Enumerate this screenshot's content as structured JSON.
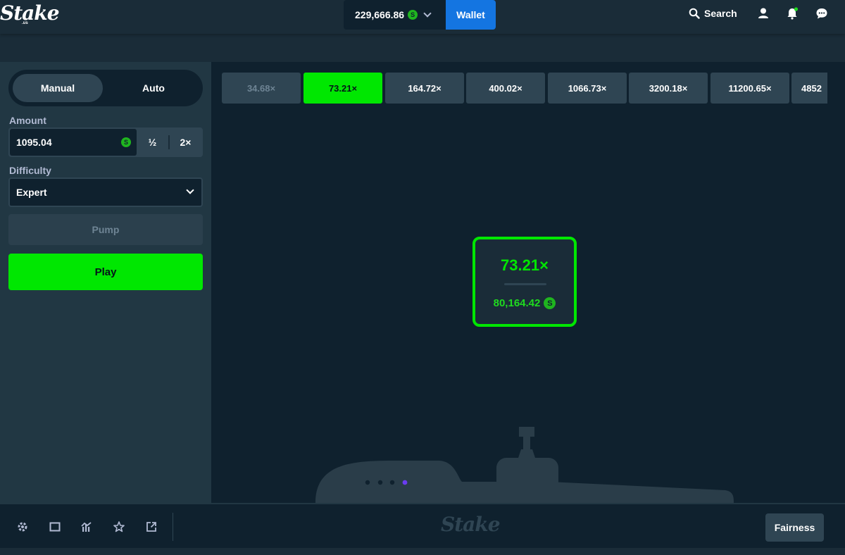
{
  "header": {
    "logo_text": "Stake",
    "logo_sub": ".us",
    "balance": "229,666.86",
    "currency_symbol": "S",
    "wallet_label": "Wallet",
    "search_label": "Search",
    "icons": [
      "search-icon",
      "user-icon",
      "notification-bell-icon",
      "chat-icon"
    ]
  },
  "sidebar": {
    "tabs": [
      {
        "label": "Manual",
        "active": true
      },
      {
        "label": "Auto",
        "active": false
      }
    ],
    "amount_label": "Amount",
    "amount_value": "1095.04",
    "currency_symbol": "S",
    "half_label": "½",
    "double_label": "2×",
    "difficulty_label": "Difficulty",
    "difficulty_value": "Expert",
    "pump_label": "Pump",
    "play_label": "Play"
  },
  "game": {
    "multipliers": [
      {
        "label": "34.68×",
        "state": "past"
      },
      {
        "label": "73.21×",
        "state": "current"
      },
      {
        "label": "164.72×",
        "state": "upcoming"
      },
      {
        "label": "400.02×",
        "state": "upcoming"
      },
      {
        "label": "1066.73×",
        "state": "upcoming"
      },
      {
        "label": "3200.18×",
        "state": "upcoming"
      },
      {
        "label": "11200.65×",
        "state": "upcoming"
      },
      {
        "label": "4852",
        "state": "upcoming"
      }
    ],
    "result": {
      "multiplier": "73.21×",
      "payout": "80,164.42",
      "currency_symbol": "S"
    }
  },
  "footer": {
    "icons": [
      "settings-icon",
      "theatre-mode-icon",
      "live-stats-icon",
      "favorite-star-icon",
      "popout-icon"
    ],
    "logo_text": "Stake",
    "fairness_label": "Fairness"
  },
  "colors": {
    "accent_green": "#00e701",
    "wallet_blue": "#1475e1",
    "background": "#1a2c38",
    "panel": "#213743",
    "game_bg": "#0f212e"
  }
}
